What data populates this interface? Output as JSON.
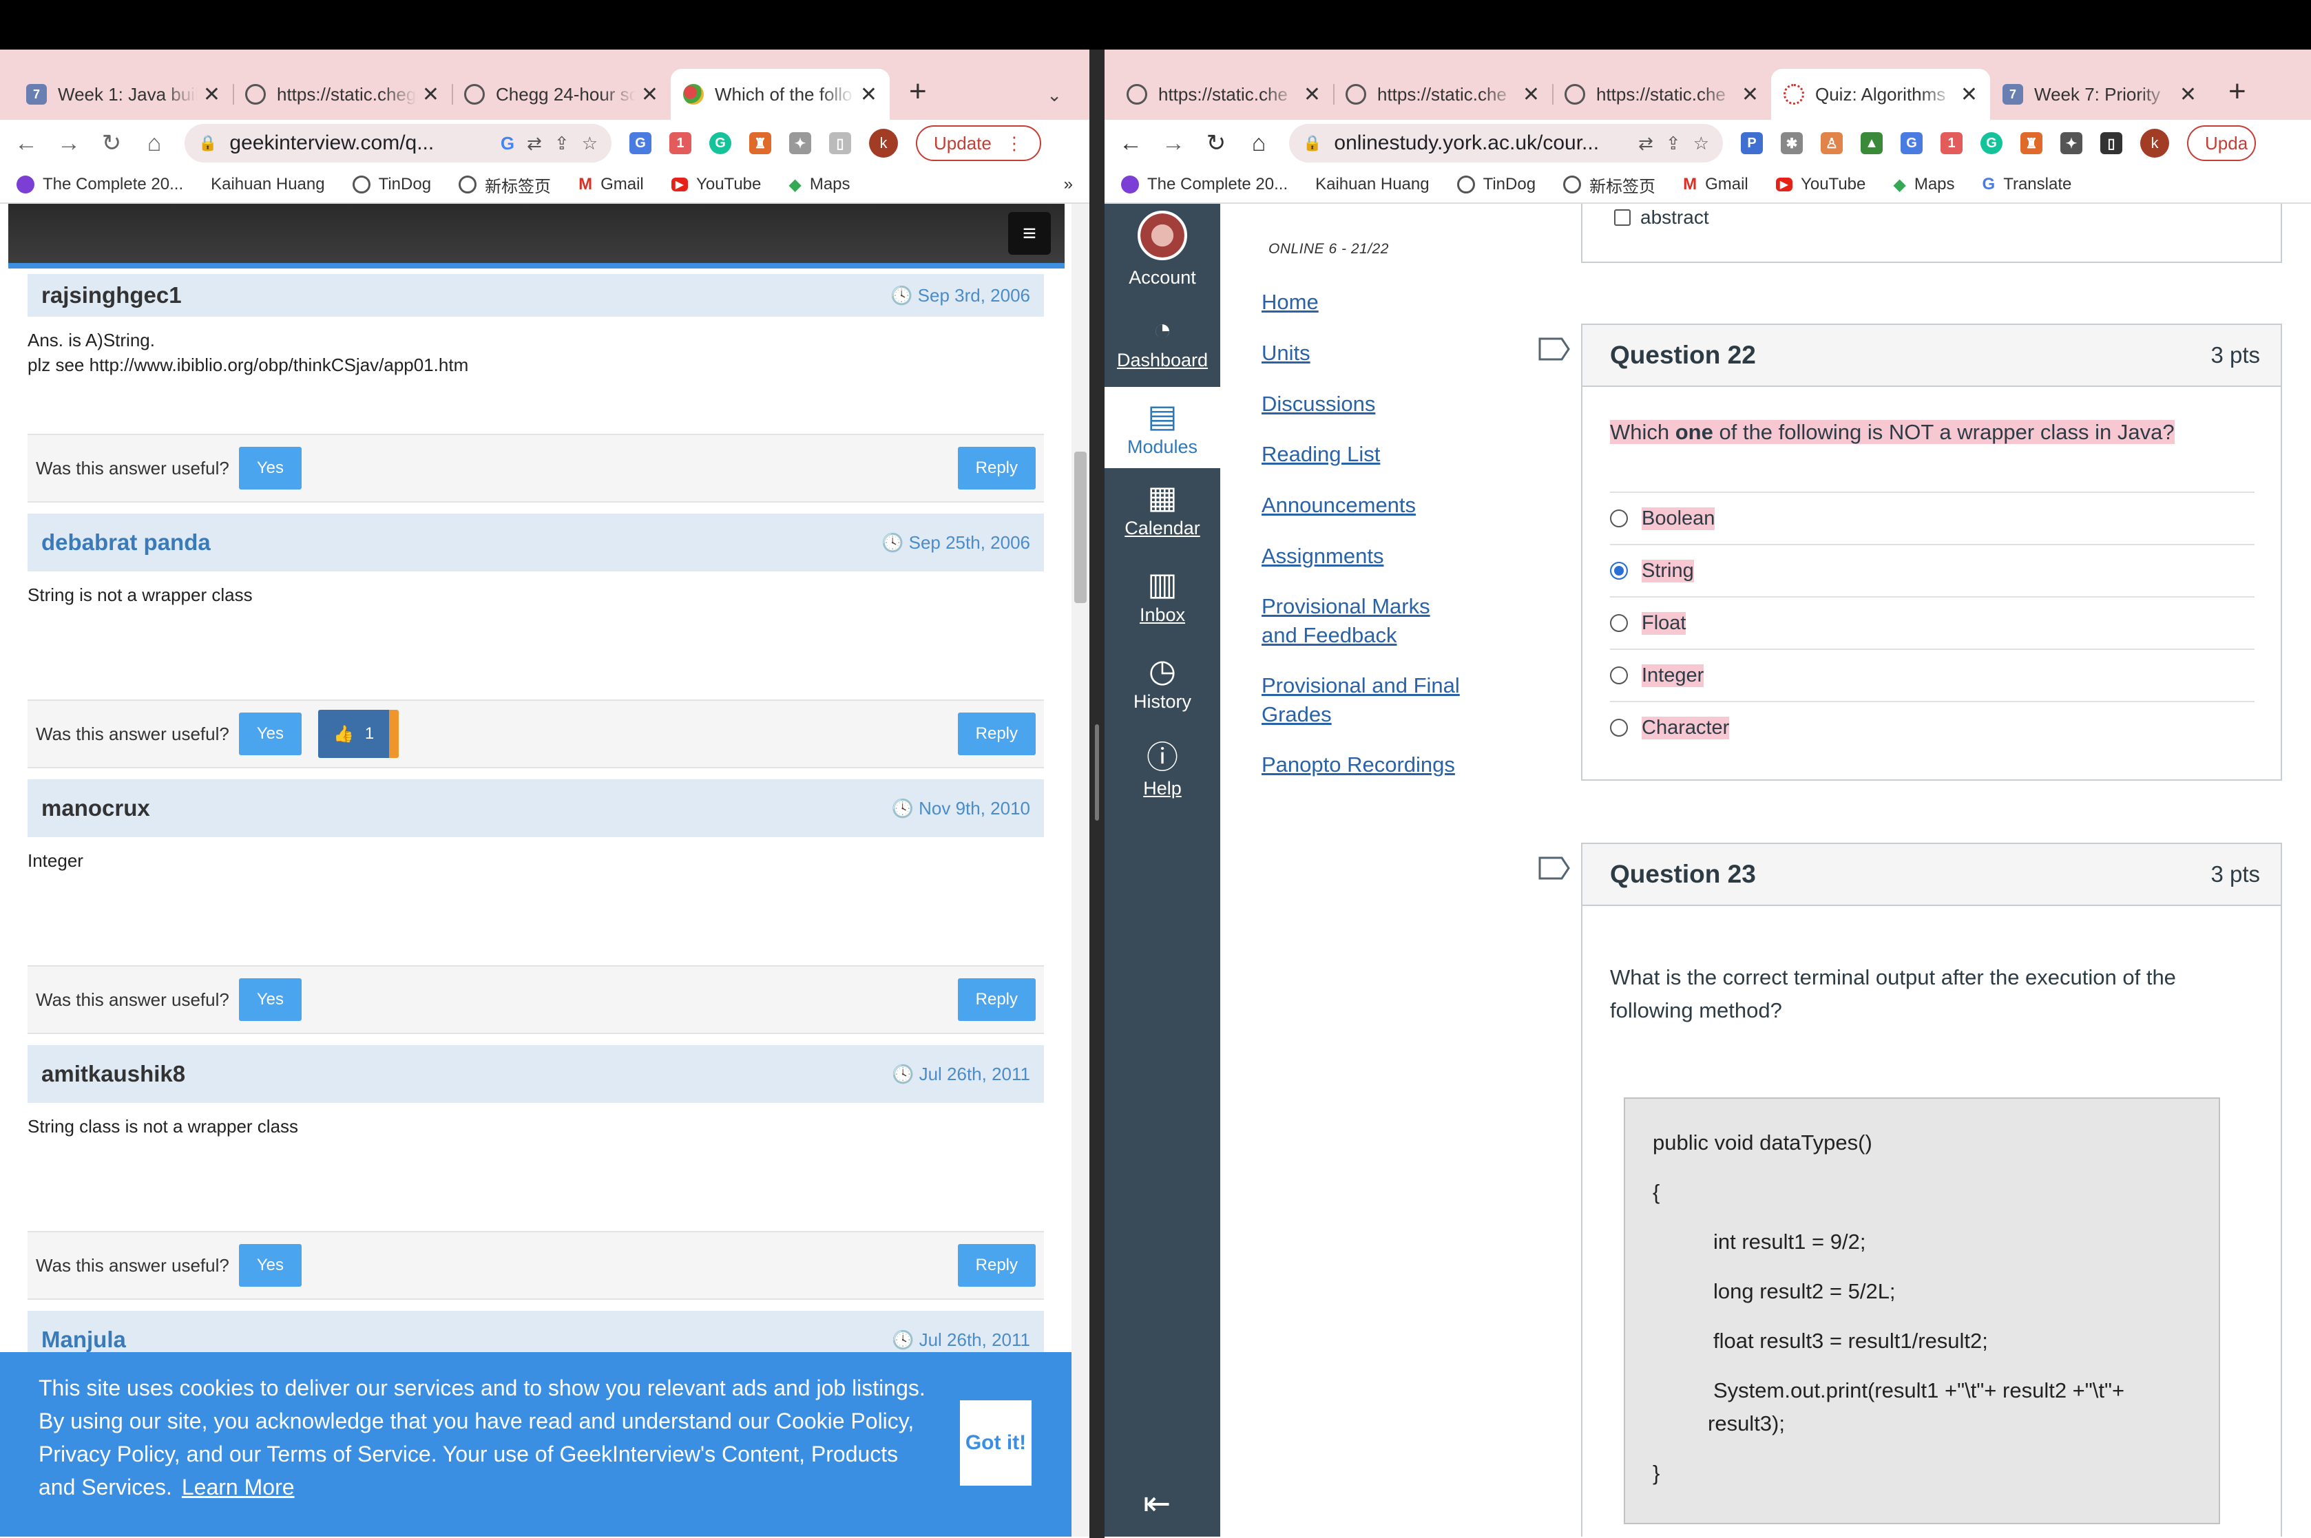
{
  "left_window": {
    "tabs": [
      {
        "title": "Week 1: Java build",
        "icon": "week-icon"
      },
      {
        "title": "https://static.cheg",
        "icon": "globe-icon"
      },
      {
        "title": "Chegg 24-hour sc",
        "icon": "globe-icon"
      },
      {
        "title": "Which of the follo",
        "icon": "multi-color-icon",
        "active": true
      }
    ],
    "url": "geekinterview.com/q...",
    "update_label": "Update",
    "avatar_letter": "k",
    "bookmarks": [
      "The Complete 20...",
      "Kaihuan Huang",
      "TinDog",
      "新标签页",
      "Gmail",
      "YouTube",
      "Maps"
    ],
    "posts": [
      {
        "user": "rajsinghgec1",
        "date": "Sep 3rd, 2006",
        "body": [
          "Ans. is A)String.",
          "plz see http://www.ibiblio.org/obp/thinkCSjav/app01.htm"
        ]
      },
      {
        "user": "debabrat panda",
        "date": "Sep 25th, 2006",
        "body": [
          "String is not a wrapper class"
        ]
      },
      {
        "user": "manocrux",
        "date": "Nov 9th, 2010",
        "body": [
          "Integer"
        ]
      },
      {
        "user": "amitkaushik8",
        "date": "Jul 26th, 2011",
        "body": [
          "String class is not a wrapper class"
        ]
      },
      {
        "user": "Manjula",
        "date": "Jul 26th, 2011",
        "body": []
      }
    ],
    "useful_label": "Was this answer useful?",
    "yes_label": "Yes",
    "reply_label": "Reply",
    "vote_count": "1",
    "cookie": {
      "text": "This site uses cookies to deliver our services and to show you relevant ads and job listings. By using our site, you acknowledge that you have read and understand our Cookie Policy, Privacy Policy, and our Terms of Service. Your use of GeekInterview's Content, Products and Services.",
      "learn_more": "Learn More",
      "got_it": "Got it!"
    }
  },
  "right_window": {
    "tabs": [
      {
        "title": "https://static.che",
        "icon": "globe-icon"
      },
      {
        "title": "https://static.che",
        "icon": "globe-icon"
      },
      {
        "title": "https://static.che",
        "icon": "globe-icon"
      },
      {
        "title": "Quiz: Algorithms",
        "icon": "quiz-icon",
        "active": true
      },
      {
        "title": "Week 7: Priority",
        "icon": "week-icon"
      }
    ],
    "url": "onlinestudy.york.ac.uk/cour...",
    "update_label": "Upda",
    "avatar_letter": "k",
    "bookmarks": [
      "The Complete 20...",
      "Kaihuan Huang",
      "TinDog",
      "新标签页",
      "Gmail",
      "YouTube",
      "Maps",
      "Translate"
    ],
    "global_nav": [
      {
        "label": "Account",
        "icon": "account-avatar"
      },
      {
        "label": "Dashboard",
        "icon": "dashboard-icon"
      },
      {
        "label": "Modules",
        "icon": "modules-icon",
        "active": true
      },
      {
        "label": "Calendar",
        "icon": "calendar-icon"
      },
      {
        "label": "Inbox",
        "icon": "inbox-icon"
      },
      {
        "label": "History",
        "icon": "history-icon"
      },
      {
        "label": "Help",
        "icon": "help-icon"
      }
    ],
    "course_label": "ONLINE 6 - 21/22",
    "course_menu": [
      "Home",
      "Units",
      "Discussions",
      "Reading List",
      "Announcements",
      "Assignments",
      "Provisional Marks and Feedback",
      "Provisional and Final Grades",
      "Panopto Recordings"
    ],
    "prev_option": "abstract",
    "q22": {
      "title": "Question 22",
      "points": "3 pts",
      "text_before": "Which ",
      "text_bold": "one",
      "text_after": " of the following is NOT a wrapper class in Java?",
      "answers": [
        "Boolean",
        "String",
        "Float",
        "Integer",
        "Character"
      ],
      "selected": "String"
    },
    "q23": {
      "title": "Question 23",
      "points": "3 pts",
      "text": "What is the correct terminal output after the execution of the following method?",
      "code": [
        "public void dataTypes()",
        "{",
        "int result1 = 9/2;",
        "long result2 = 5/2L;",
        "float result3 = result1/result2;",
        "System.out.print(result1 +\"\\t\"+ result2 +\"\\t\"+",
        "result3);",
        "}"
      ]
    }
  }
}
